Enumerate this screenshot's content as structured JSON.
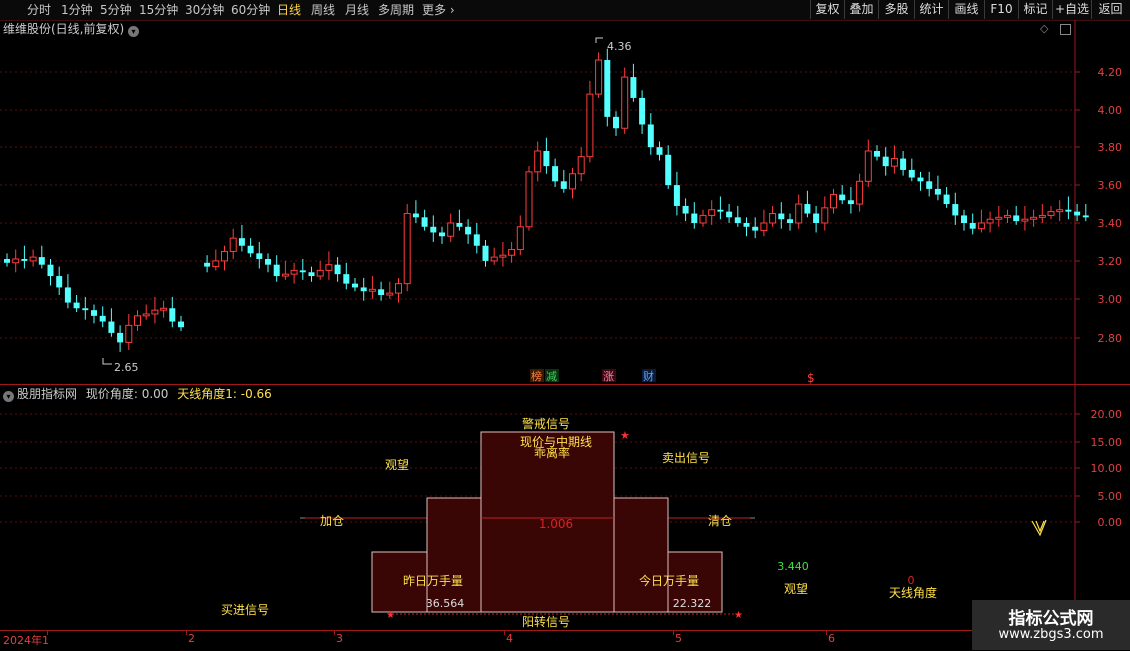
{
  "toolbar": {
    "periods": [
      "分时",
      "1分钟",
      "5分钟",
      "15分钟",
      "30分钟",
      "60分钟",
      "日线",
      "周线",
      "月线",
      "多周期",
      "更多"
    ],
    "active_period": "日线",
    "more_arrow": "›",
    "buttons": [
      "复权",
      "叠加",
      "多股",
      "统计",
      "画线",
      "F10",
      "标记",
      "+自选",
      "返回"
    ]
  },
  "main_chart": {
    "title": "维维股份(日线,前复权)",
    "y_ticks": [
      "4.20",
      "4.00",
      "3.80",
      "3.60",
      "3.40",
      "3.20",
      "3.00",
      "2.80"
    ],
    "high_label": "4.36",
    "low_label": "2.65",
    "event_markers": [
      "榜",
      "减",
      "涨",
      "财",
      "$"
    ],
    "colors": {
      "up": "#ff3c3c",
      "down": "#54ffff",
      "grid": "#5a0f0f",
      "axis_text": "#e04040"
    }
  },
  "indicator": {
    "title": "股朋指标网",
    "value_text": "现价角度: 0.00",
    "angle_text": "天线角度1: -0.66",
    "y_ticks": [
      "20.00",
      "15.00",
      "10.00",
      "5.00",
      "0.00"
    ],
    "labels": {
      "warning": "警戒信号",
      "deviation_line1": "现价与中期线",
      "deviation_line2": "乖离率",
      "watch_left": "观望",
      "sell": "卖出信号",
      "add": "加仓",
      "clear": "清仓",
      "center_value": "1.006",
      "yesterday_vol": "昨日万手量",
      "today_vol": "今日万手量",
      "yesterday_value": "36.564",
      "today_value": "22.322",
      "buy": "买进信号",
      "reverse": "阳转信号",
      "green_value": "3.440",
      "watch_right": "观望",
      "zero_value": "0",
      "antenna": "天线角度",
      "star": "★"
    }
  },
  "x_axis": {
    "labels": [
      "2024年1",
      "2",
      "3",
      "4",
      "5",
      "6"
    ]
  },
  "watermark": {
    "title": "指标公式网",
    "url": "www.zbgs3.com"
  }
}
